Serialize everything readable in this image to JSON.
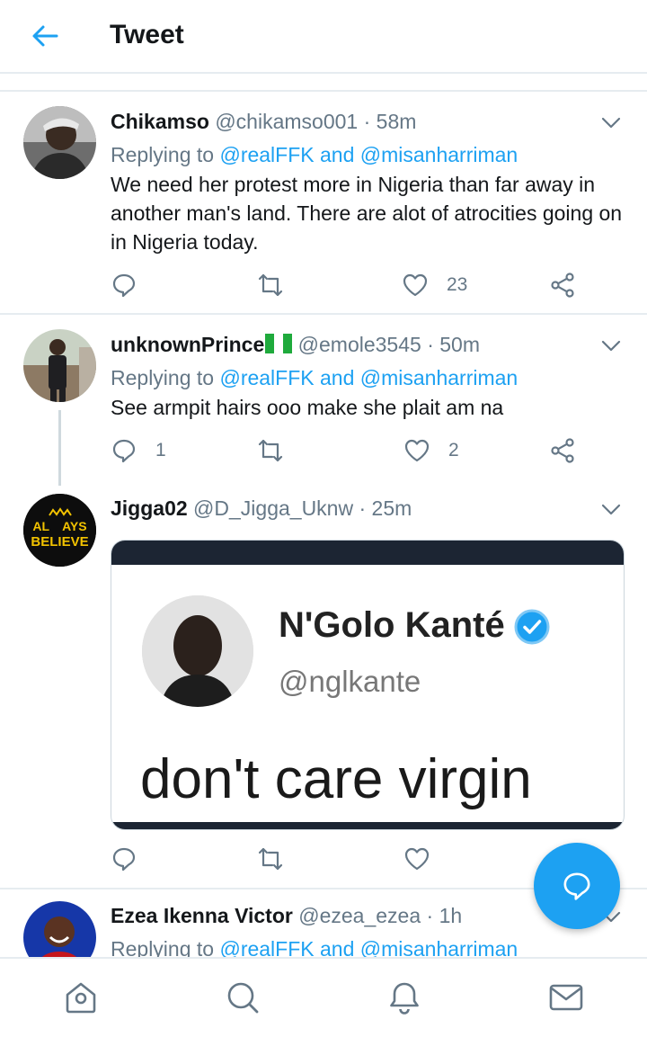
{
  "header": {
    "title": "Tweet",
    "back_icon": "arrow-left-icon"
  },
  "colors": {
    "accent": "#1da1f2",
    "secondary_text": "#657786",
    "divider": "#e6ecf0"
  },
  "tweets": [
    {
      "name": "Chikamso",
      "handle": "@chikamso001",
      "time": "58m",
      "replying_prefix": "Replying to",
      "replying_to_1": "@realFFK",
      "replying_and": "and",
      "replying_to_2": "@misanharriman",
      "text": "We need her protest more in Nigeria than far away in another man's land. There are alot of atrocities going on in Nigeria today.",
      "replies": "",
      "retweets": "",
      "likes": "23"
    },
    {
      "name": "unknownPrince",
      "flag": "Nigeria flag",
      "handle": "@emole3545",
      "time": "50m",
      "replying_prefix": "Replying to",
      "replying_to_1": "@realFFK",
      "replying_and": "and",
      "replying_to_2": "@misanharriman",
      "text": "See armpit hairs ooo make she plait am na",
      "replies": "1",
      "retweets": "",
      "likes": "2"
    },
    {
      "name": "Jigga02",
      "handle": "@D_Jigga_Uknw",
      "time": "25m",
      "avatar_text_1": "AL",
      "avatar_text_2": "AYS",
      "avatar_text_3": "BELIEVE",
      "media": {
        "name": "N'Golo Kanté",
        "handle": "@nglkante",
        "text": "don't care virgin"
      }
    },
    {
      "name": "Ezea Ikenna Victor",
      "handle": "@ezea_ezea",
      "time": "1h",
      "replying_prefix": "Replying to",
      "replying_to_1": "@realFFK",
      "replying_and": "and",
      "replying_to_2": "@misanharriman"
    }
  ],
  "bottom_nav": [
    "home-icon",
    "search-icon",
    "notifications-icon",
    "messages-icon"
  ],
  "fab": {
    "icon": "compose-reply-icon"
  }
}
